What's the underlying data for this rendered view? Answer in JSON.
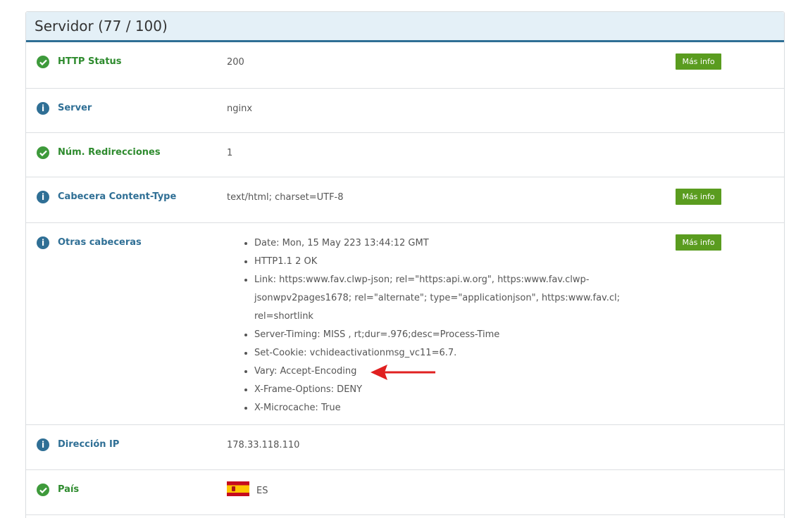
{
  "panel": {
    "title": "Servidor (77 / 100)"
  },
  "rows": [
    {
      "label": "HTTP Status",
      "status": "ok",
      "value": "200",
      "button": "Más info"
    },
    {
      "label": "Server",
      "status": "info",
      "value": "nginx"
    },
    {
      "label": "Núm. Redirecciones",
      "status": "ok",
      "value": "1"
    },
    {
      "label": "Cabecera Content-Type",
      "status": "info",
      "value": "text/html; charset=UTF-8",
      "button": "Más info"
    },
    {
      "label": "Otras cabeceras",
      "status": "info",
      "button": "Más info",
      "headers": [
        "Date: Mon, 15 May 223 13:44:12 GMT",
        "HTTP1.1 2 OK",
        "Link: https:www.fav.clwp-json; rel=\"https:api.w.org\", https:www.fav.clwp-",
        "jsonwpv2pages1678; rel=\"alternate\"; type=\"applicationjson\", https:www.fav.cl; rel=shortlink",
        "Server-Timing: MISS , rt;dur=.976;desc=Process-Time",
        "Set-Cookie: vchideactivationmsg_vc11=6.7.",
        "Vary: Accept-Encoding",
        "X-Frame-Options: DENY",
        "X-Microcache: True"
      ]
    },
    {
      "label": "Dirección IP",
      "status": "info",
      "value": "178.33.118.110"
    },
    {
      "label": "País",
      "status": "ok",
      "value": "ES",
      "flag": "spain-flag"
    }
  ],
  "icons": {
    "ok": "check-circle-icon",
    "info": "info-circle-icon"
  },
  "colors": {
    "ok": "#3e9a3b",
    "info": "#2f6f95",
    "button": "#5a9c1f",
    "header_border": "#2f6f95",
    "arrow": "#e02020"
  }
}
